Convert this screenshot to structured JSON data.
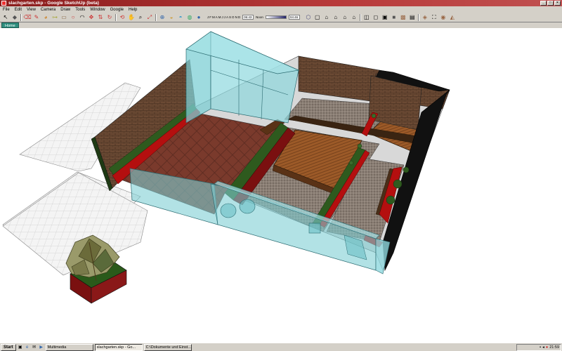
{
  "window": {
    "title": "slachgarten.skp - Google SketchUp (beta)",
    "minimize": "_",
    "maximize": "□",
    "close": "×"
  },
  "menu": {
    "items": [
      "File",
      "Edit",
      "View",
      "Camera",
      "Draw",
      "Tools",
      "Window",
      "Google",
      "Help"
    ]
  },
  "toolbar": {
    "tools": [
      {
        "name": "select-icon",
        "glyph": "↖"
      },
      {
        "name": "make-component-icon",
        "glyph": "◆"
      },
      {
        "name": "eraser-icon",
        "glyph": "⌫"
      },
      {
        "name": "pencil-icon",
        "glyph": "✎"
      },
      {
        "name": "paint-bucket-icon",
        "glyph": "◕"
      },
      {
        "name": "tape-measure-icon",
        "glyph": "⊶"
      },
      {
        "name": "rectangle-icon",
        "glyph": "▭"
      },
      {
        "name": "circle-icon",
        "glyph": "○"
      },
      {
        "name": "arc-icon",
        "glyph": "◠"
      },
      {
        "name": "move-icon",
        "glyph": "✥"
      },
      {
        "name": "push-pull-icon",
        "glyph": "⇅"
      },
      {
        "name": "rotate-icon",
        "glyph": "↻"
      },
      {
        "name": "orbit-icon",
        "glyph": "⟲"
      },
      {
        "name": "pan-icon",
        "glyph": "✋"
      },
      {
        "name": "zoom-icon",
        "glyph": "⌕"
      },
      {
        "name": "zoom-extents-icon",
        "glyph": "⤢"
      },
      {
        "name": "add-location-icon",
        "glyph": "⊕"
      },
      {
        "name": "toggle-terrain-icon",
        "glyph": "◒"
      },
      {
        "name": "get-models-icon",
        "glyph": "◓"
      },
      {
        "name": "share-model-icon",
        "glyph": "◍"
      },
      {
        "name": "place-in-earth-icon",
        "glyph": "●"
      }
    ],
    "months": [
      "J",
      "F",
      "M",
      "A",
      "M",
      "J",
      "J",
      "A",
      "S",
      "O",
      "N",
      "D"
    ],
    "time_start": "06:43",
    "noon_label": "Noon",
    "time_end": "04:46",
    "views": [
      {
        "name": "iso-view-icon",
        "glyph": "⬡"
      },
      {
        "name": "top-view-icon",
        "glyph": "▢"
      },
      {
        "name": "front-view-icon",
        "glyph": "⌂"
      },
      {
        "name": "right-view-icon",
        "glyph": "⌂"
      },
      {
        "name": "back-view-icon",
        "glyph": "⌂"
      },
      {
        "name": "left-view-icon",
        "glyph": "⌂"
      },
      {
        "name": "xray-icon",
        "glyph": "◫"
      },
      {
        "name": "wireframe-icon",
        "glyph": "◻"
      },
      {
        "name": "hidden-line-icon",
        "glyph": "▣"
      },
      {
        "name": "shaded-icon",
        "glyph": "■"
      },
      {
        "name": "shaded-texture-icon",
        "glyph": "▩"
      },
      {
        "name": "monochrome-icon",
        "glyph": "▤"
      },
      {
        "name": "section-icon",
        "glyph": "◈"
      },
      {
        "name": "walk-icon",
        "glyph": "⛶"
      },
      {
        "name": "look-around-icon",
        "glyph": "◉"
      },
      {
        "name": "position-camera-icon",
        "glyph": "◭"
      }
    ]
  },
  "scene_tab": "Home",
  "taskbar": {
    "start": "Start",
    "quicklaunch": [
      {
        "name": "desktop-icon",
        "glyph": "▣"
      },
      {
        "name": "ie-icon",
        "glyph": "e"
      },
      {
        "name": "mail-icon",
        "glyph": "✉"
      },
      {
        "name": "media-icon",
        "glyph": "▶"
      }
    ],
    "tasks": [
      {
        "label": "Multimedia",
        "active": false
      },
      {
        "label": "slachgarten.skp - Go...",
        "active": true
      },
      {
        "label": "C:\\Dokumente und Einst...",
        "active": false
      }
    ],
    "clock": "21:59"
  },
  "colors": {
    "title_bar": "#8a1c1c",
    "face_chrome": "#d4d0c8",
    "glass": "#7ecfd4",
    "terracotta_floor": "#7a3a2c",
    "brick": "#6b4a34",
    "gravel": "#8a7e74",
    "wood_deck": "#9c5a28",
    "hedge": "#2e5a1e",
    "planter_red": "#b40f0f",
    "black_wall": "#111111"
  }
}
